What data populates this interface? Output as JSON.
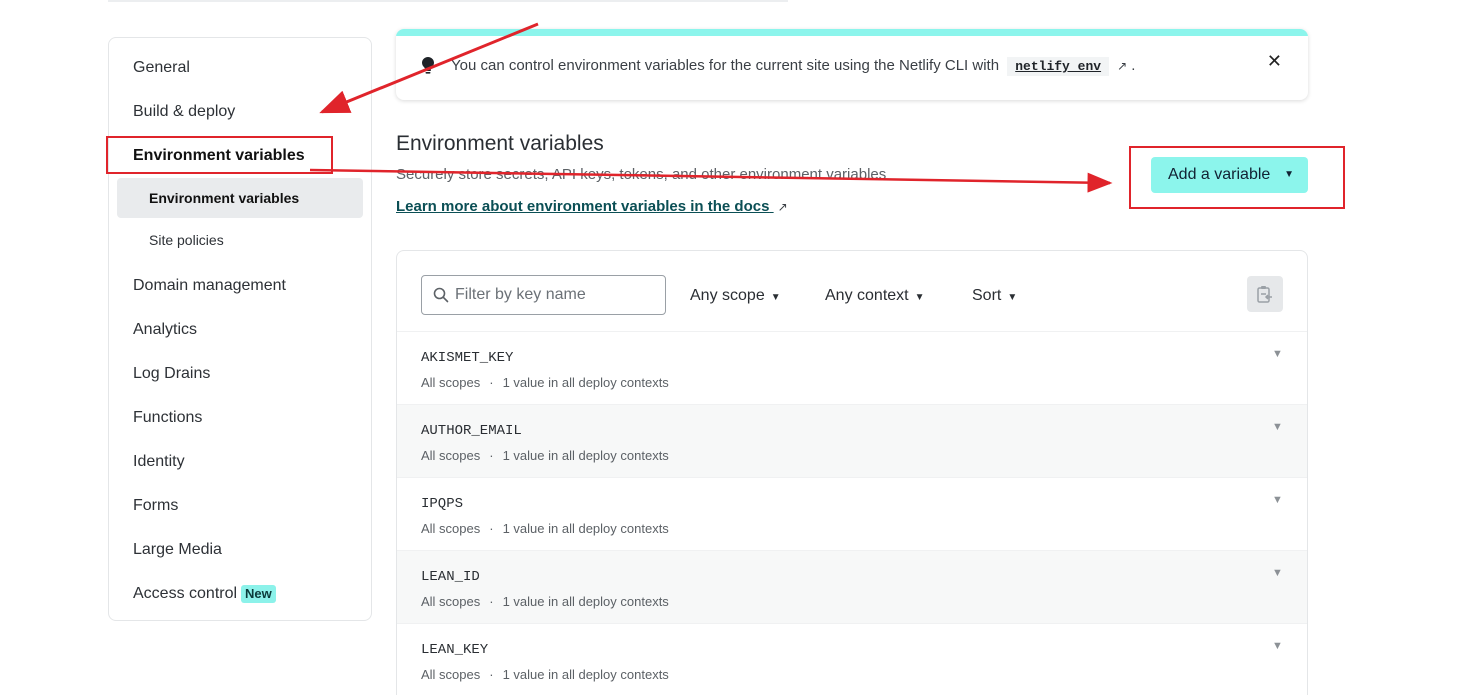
{
  "sidebar": {
    "items": [
      {
        "label": "General"
      },
      {
        "label": "Build & deploy"
      },
      {
        "label": "Environment variables"
      },
      {
        "label": "Domain management"
      },
      {
        "label": "Analytics"
      },
      {
        "label": "Log Drains"
      },
      {
        "label": "Functions"
      },
      {
        "label": "Identity"
      },
      {
        "label": "Forms"
      },
      {
        "label": "Large Media"
      },
      {
        "label": "Access control",
        "badge": "New"
      }
    ],
    "sub_items": [
      {
        "label": "Environment variables"
      },
      {
        "label": "Site policies"
      }
    ]
  },
  "banner": {
    "text_before": "You can control environment variables for the current site using the Netlify CLI with",
    "code": "netlify env",
    "text_after": ".",
    "icon": "lightbulb-icon",
    "close_icon": "close-icon"
  },
  "main": {
    "title": "Environment variables",
    "description": "Securely store secrets, API keys, tokens, and other environment variables",
    "docs_link": "Learn more about environment variables in the docs",
    "add_button": "Add a variable"
  },
  "toolbar": {
    "filter_placeholder": "Filter by key name",
    "scope": "Any scope",
    "context": "Any context",
    "sort": "Sort"
  },
  "variables": [
    {
      "key": "AKISMET_KEY",
      "scope": "All scopes",
      "values": "1 value in all deploy contexts"
    },
    {
      "key": "AUTHOR_EMAIL",
      "scope": "All scopes",
      "values": "1 value in all deploy contexts"
    },
    {
      "key": "IPQPS",
      "scope": "All scopes",
      "values": "1 value in all deploy contexts"
    },
    {
      "key": "LEAN_ID",
      "scope": "All scopes",
      "values": "1 value in all deploy contexts"
    },
    {
      "key": "LEAN_KEY",
      "scope": "All scopes",
      "values": "1 value in all deploy contexts"
    }
  ],
  "colors": {
    "accent": "#8cf5ec",
    "annotation": "#e0242b",
    "link": "#0b4f55"
  }
}
